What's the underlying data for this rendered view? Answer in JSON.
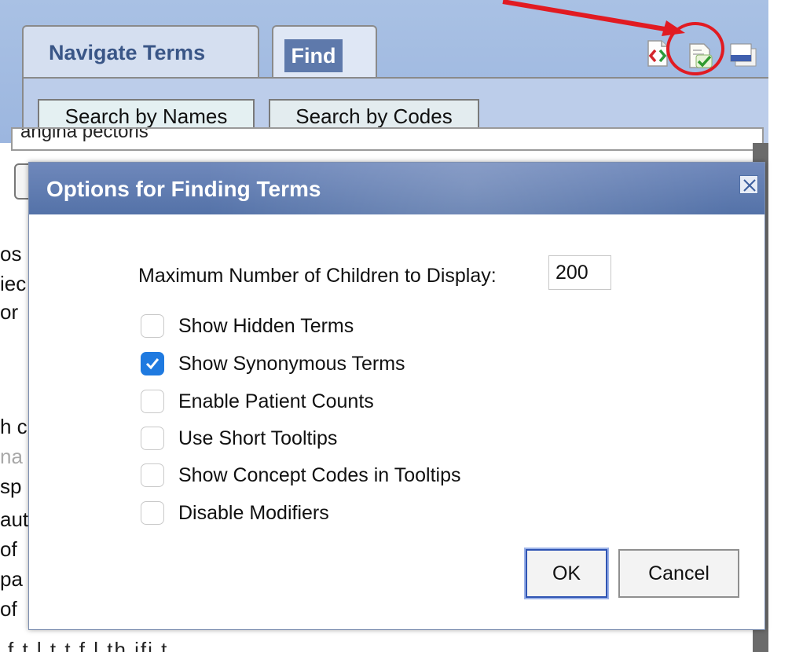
{
  "tabs": {
    "navigate_label": "Navigate Terms",
    "find_label": "Find"
  },
  "subtabs": {
    "names_label": "Search by Names",
    "codes_label": "Search by Codes"
  },
  "background": {
    "search_value": "angina pectoris",
    "fragments": [
      "os",
      "iec",
      "or",
      "h c",
      "na",
      "sp",
      "aut",
      "of",
      "pa",
      "of"
    ],
    "bottom_text": "f   t   l     t   t   f   l   th       ifi   t"
  },
  "dialog": {
    "title": "Options for Finding Terms",
    "max_children_label": "Maximum Number of Children to Display:",
    "max_children_value": "200",
    "options": [
      {
        "label": "Show Hidden Terms",
        "checked": false
      },
      {
        "label": "Show Synonymous Terms",
        "checked": true
      },
      {
        "label": "Enable Patient Counts",
        "checked": false
      },
      {
        "label": "Use Short Tooltips",
        "checked": false
      },
      {
        "label": "Show Concept Codes in Tooltips",
        "checked": false
      },
      {
        "label": "Disable Modifiers",
        "checked": false
      }
    ],
    "ok_label": "OK",
    "cancel_label": "Cancel"
  },
  "icons": {
    "header": [
      "code-view-icon",
      "find-options-icon",
      "window-icon"
    ],
    "close": "close-icon",
    "check": "checkmark-icon"
  },
  "colors": {
    "annotation_red": "#e11b22",
    "title_bar": "#5472a8",
    "checkbox_checked": "#1f7ae0"
  }
}
